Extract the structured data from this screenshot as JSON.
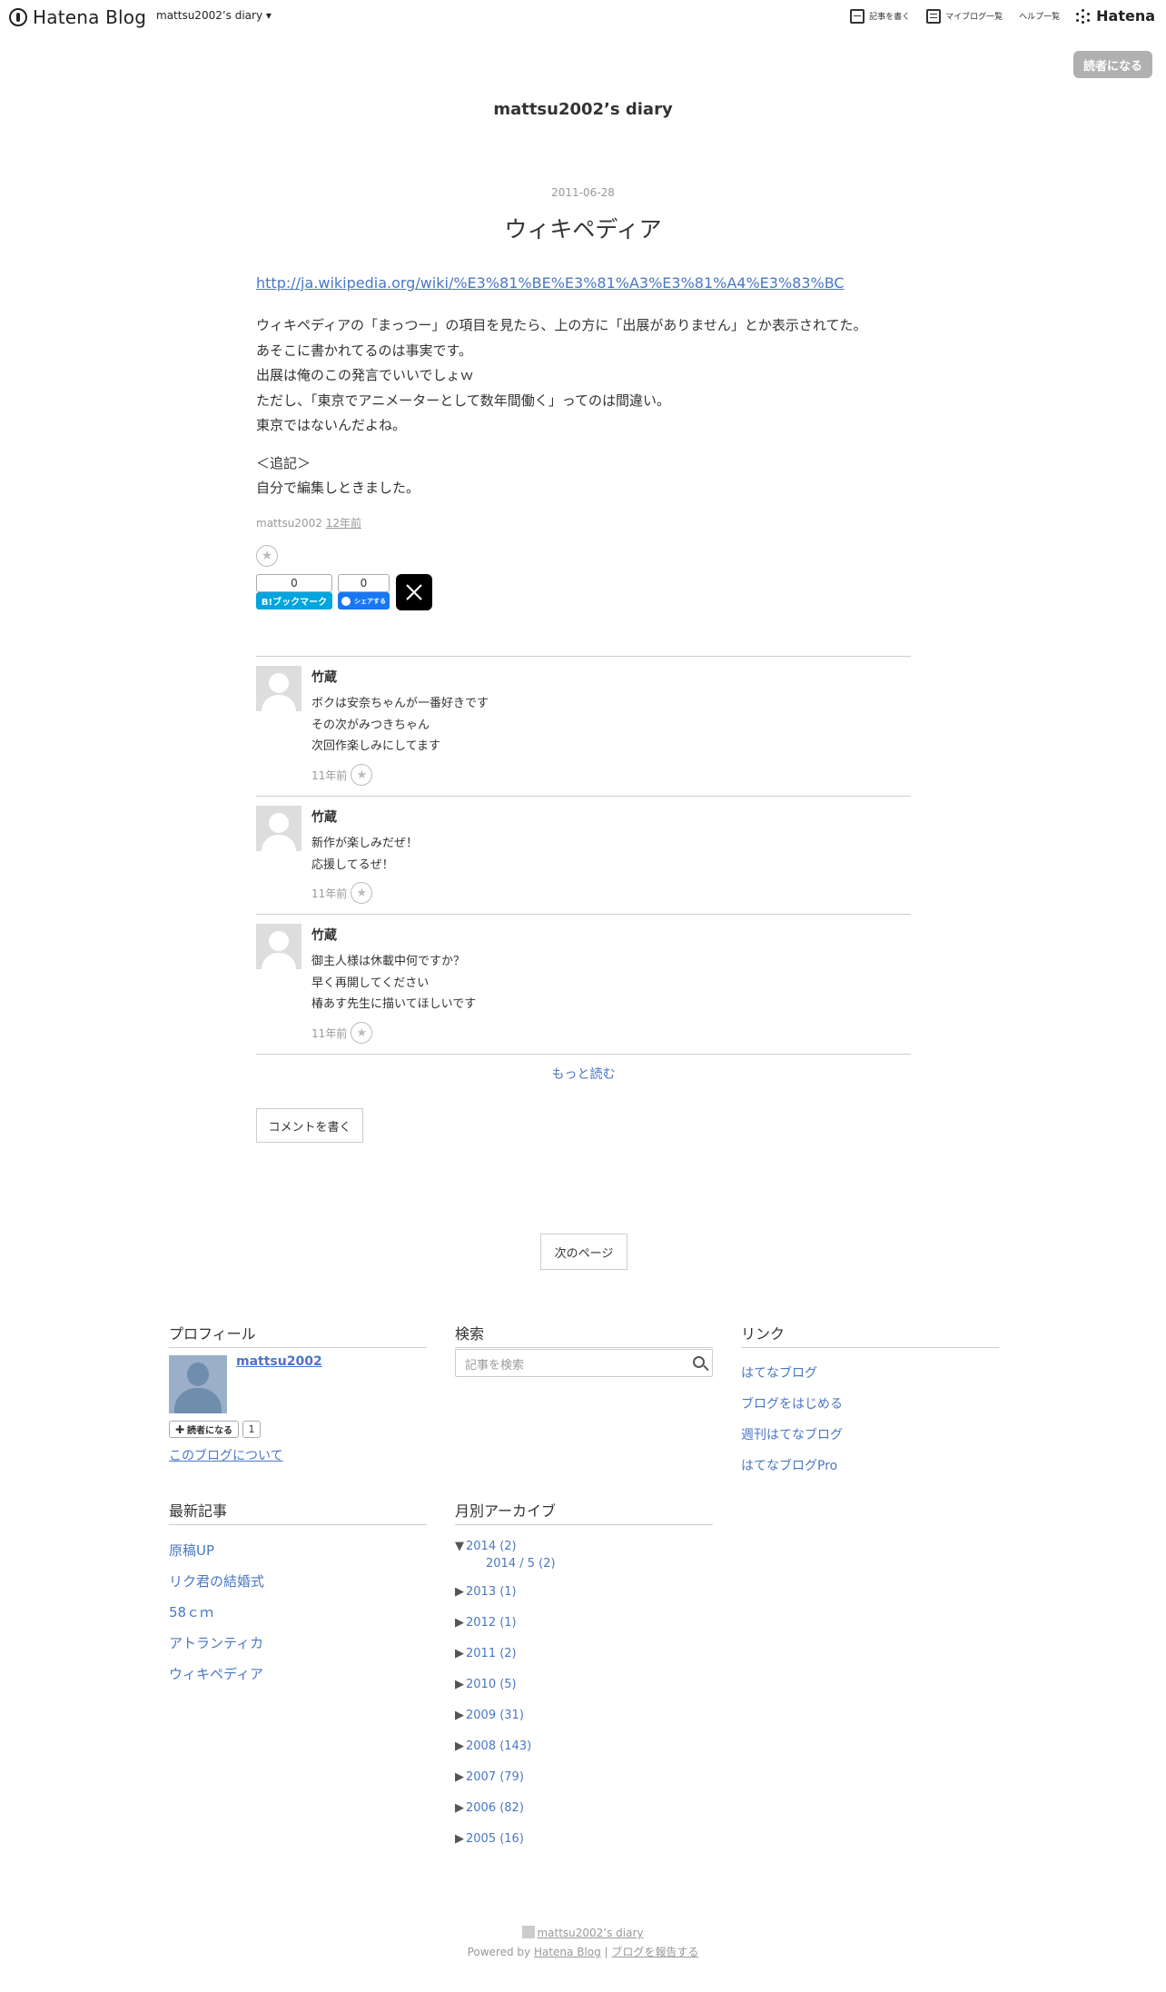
{
  "header": {
    "logo_text": "Hatena Blog",
    "blog_name": "mattsu2002’s diary ▾",
    "nav": [
      "記事を書く",
      "マイブログ一覧",
      "ヘルプ一覧"
    ],
    "hatena": "Hatena"
  },
  "subscribe_top": "読者になる",
  "blog_title": "mattsu2002’s diary",
  "entry": {
    "date": "2011-06-28",
    "title": "ウィキペディア",
    "link": "http://ja.wikipedia.org/wiki/%E3%81%BE%E3%81%A3%E3%81%A4%E3%83%BC",
    "body": [
      "ウィキペディアの「まっつー」の項目を見たら、上の方に「出展がありません」とか表示されてた。",
      "あそこに書かれてるのは事実です。",
      "出展は俺のこの発言でいいでしょｗ",
      "ただし、「東京でアニメーターとして数年間働く」ってのは間違い。",
      "東京ではないんだよね。",
      "＜追記＞",
      "自分で編集しときました。"
    ],
    "author": "mattsu2002",
    "ago": "12年前"
  },
  "share": {
    "bookmark_count": "0",
    "bookmark_label": "B!ブックマーク",
    "facebook_count": "0",
    "facebook_label": "シェアする",
    "x_label": "X"
  },
  "comments": [
    {
      "name": "竹蔵",
      "lines": [
        "ボクは安奈ちゃんが一番好きです",
        "その次がみつきちゃん",
        "次回作楽しみにしてます"
      ],
      "ago": "11年前"
    },
    {
      "name": "竹蔵",
      "lines": [
        "新作が楽しみだぜ！",
        "応援してるぜ！"
      ],
      "ago": "11年前"
    },
    {
      "name": "竹蔵",
      "lines": [
        "御主人様は休載中何ですか？",
        "早く再開してください",
        "椿あす先生に描いてほしいです"
      ],
      "ago": "11年前"
    }
  ],
  "more_label": "もっと読む",
  "write_comment_label": "コメントを書く",
  "next_page_label": "次のページ",
  "sidebar": {
    "profile": {
      "title": "プロフィール",
      "name": "mattsu2002",
      "subscribe": "読者になる",
      "count": "1",
      "about": "このブログについて"
    },
    "search": {
      "title": "検索",
      "placeholder": "記事を検索"
    },
    "links": {
      "title": "リンク",
      "items": [
        "はてなブログ",
        "ブログをはじめる",
        "週刊はてなブログ",
        "はてなブログPro"
      ]
    },
    "recent": {
      "title": "最新記事",
      "items": [
        "原稿UP",
        "リク君の結婚式",
        "58ｃｍ",
        "アトランティカ",
        "ウィキペディア"
      ]
    },
    "archive": {
      "title": "月別アーカイブ",
      "open_year": "2014 (2)",
      "open_child": "2014 / 5 (2)",
      "years": [
        "2013 (1)",
        "2012 (1)",
        "2011 (2)",
        "2010 (5)",
        "2009 (31)",
        "2008 (143)",
        "2007 (79)",
        "2006 (82)",
        "2005 (16)"
      ]
    }
  },
  "footer": {
    "blog_link": "mattsu2002’s diary",
    "powered": "Powered by",
    "hatena_blog": "Hatena Blog",
    "separator": "|",
    "report": "ブログを報告する"
  }
}
